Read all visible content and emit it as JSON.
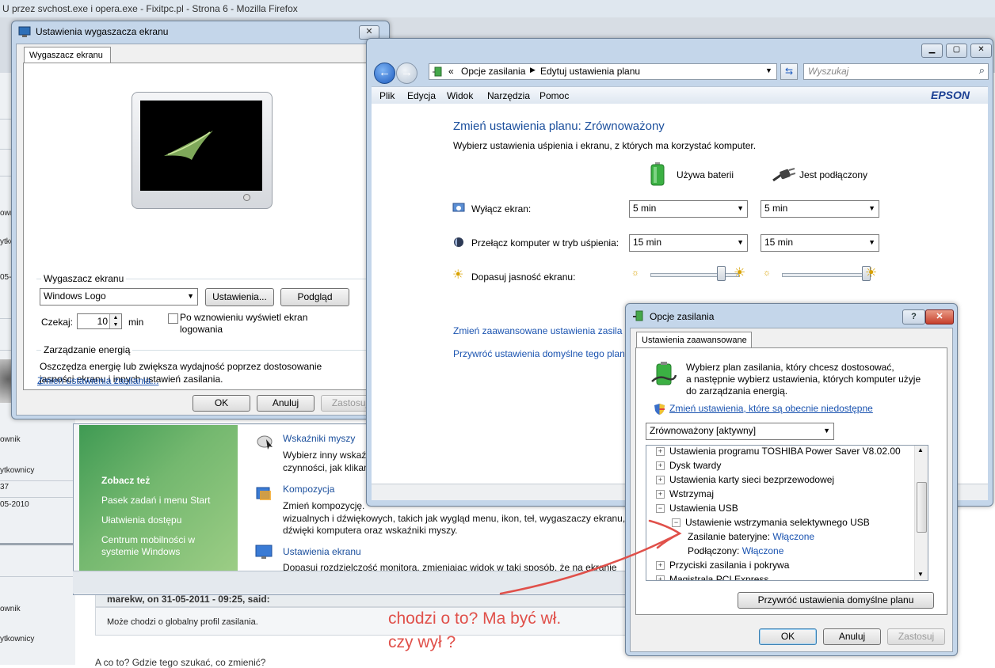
{
  "firefox": {
    "title": "U przez svchost.exe i opera.exe - Fixitpc.pl - Strona 6 - Mozilla Firefox",
    "forum_left": [
      "own",
      "ytko",
      "05-",
      "ownik",
      "ytkownicy",
      "37",
      "05-2010",
      "ownik",
      "ytkownicy"
    ],
    "post_header": "marekw, on 31-05-2011 - 09:25, said:",
    "post_quote": "Może chodzi o globalny profil zasilania.",
    "post_bottom": "A co to? Gdzie tego szukać, co zmienić?"
  },
  "control_panel_back": {
    "see_also_title": "Zobacz też",
    "see_also": [
      "Pasek zadań i menu Start",
      "Ułatwienia dostępu",
      "Centrum mobilności w",
      "systemie Windows"
    ],
    "items": [
      {
        "title": "Wskaźniki myszy",
        "text1": "Wybierz inny wskaź",
        "text2": "czynności, jak klikan"
      },
      {
        "title": "Kompozycja",
        "text1": "Zmień kompozycję.",
        "text2": "wizualnych i dźwiękowych, takich jak wygląd menu, ikon, teł, wygaszaczy ekranu,",
        "text3": "dźwięki komputera oraz wskaźniki myszy."
      },
      {
        "title": "Ustawienia ekranu",
        "text1": "Dopasuj rozdzielczość monitora, zmieniając widok w taki sposób, że na ekranie mi"
      }
    ]
  },
  "screensaver": {
    "title": "Ustawienia wygaszacza ekranu",
    "tab": "Wygaszacz ekranu",
    "group_label": "Wygaszacz ekranu",
    "selected": "Windows Logo",
    "settings_btn": "Ustawienia...",
    "preview_btn": "Podgląd",
    "wait_label": "Czekaj:",
    "wait_value": "10",
    "wait_unit": "min",
    "resume_label_1": "Po wznowieniu wyświetl ekran",
    "resume_label_2": "logowania",
    "power_group": "Zarządzanie energią",
    "power_text_1": "Oszczędza energię lub zwiększa wydajność poprzez dostosowanie",
    "power_text_2": "jasności ekranu i innych ustawień zasilania.",
    "power_link": "Zmień ustawienia zasilania...",
    "ok": "OK",
    "cancel": "Anuluj",
    "apply": "Zastosuj"
  },
  "edit_plan": {
    "breadcrumb_prefix": "«",
    "crumb1": "Opcje zasilania",
    "crumb2": "Edytuj ustawienia planu",
    "search_placeholder": "Wyszukaj",
    "menu": [
      "Plik",
      "Edycja",
      "Widok",
      "Narzędzia",
      "Pomoc"
    ],
    "brand": "EPSON",
    "heading": "Zmień ustawienia planu: Zrównoważony",
    "subheading": "Wybierz ustawienia uśpienia i ekranu, z których ma korzystać komputer.",
    "col_battery": "Używa baterii",
    "col_plugged": "Jest podłączony",
    "row_display": "Wyłącz ekran:",
    "row_sleep": "Przełącz komputer w tryb uśpienia:",
    "row_brightness": "Dopasuj jasność ekranu:",
    "display_battery": "5 min",
    "display_plugged": "5 min",
    "sleep_battery": "15 min",
    "sleep_plugged": "15 min",
    "brightness_battery": 0.8,
    "brightness_plugged": 0.95,
    "link_advanced": "Zmień zaawansowane ustawienia zasila",
    "link_restore": "Przywróć ustawienia domyślne tego planu"
  },
  "power_options": {
    "title": "Opcje zasilania",
    "tab": "Ustawienia zaawansowane",
    "intro_1": "Wybierz plan zasilania, który chcesz dostosować,",
    "intro_2": "a następnie wybierz ustawienia, których komputer użyje",
    "intro_3": "do zarządzania energią.",
    "change_link": "Zmień ustawienia, które są obecnie niedostępne",
    "plan_selected": "Zrównoważony [aktywny]",
    "tree": [
      {
        "label": "Ustawienia programu TOSHIBA Power Saver V8.02.00",
        "sign": "+"
      },
      {
        "label": "Dysk twardy",
        "sign": "+"
      },
      {
        "label": "Ustawienia karty sieci bezprzewodowej",
        "sign": "+"
      },
      {
        "label": "Wstrzymaj",
        "sign": "+"
      },
      {
        "label": "Ustawienia USB",
        "sign": "−"
      },
      {
        "label": "Ustawienie wstrzymania selektywnego USB",
        "sign": "−"
      }
    ],
    "battery_label": "Zasilanie bateryjne:",
    "battery_value": "Włączone",
    "plugged_label": "Podłączony:",
    "plugged_value": "Włączone",
    "tree_after": [
      {
        "label": "Przyciski zasilania i pokrywa",
        "sign": "+"
      },
      {
        "label": "Magistrala PCI Express",
        "sign": "+"
      }
    ],
    "restore_btn": "Przywróć ustawienia domyślne planu",
    "ok": "OK",
    "cancel": "Anuluj",
    "apply": "Zastosuj"
  },
  "annotation": {
    "line1": "chodzi o to? Ma być wł.",
    "line2": "czy wył ?",
    "color": "#e0504a"
  }
}
